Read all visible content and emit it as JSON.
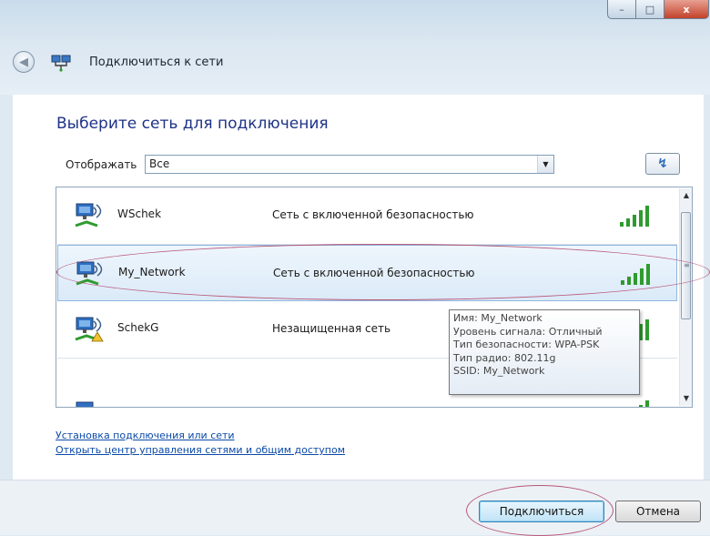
{
  "window": {
    "title": "Подключиться к сети",
    "controls": {
      "minimize": "–",
      "maximize": "□",
      "close": "x"
    }
  },
  "content": {
    "heading": "Выберите сеть для подключения",
    "filter": {
      "label": "Отображать",
      "value": "Все"
    }
  },
  "networks": [
    {
      "name": "WSchek",
      "status": "Сеть с включенной безопасностью",
      "secured": true,
      "signal_bars": 5
    },
    {
      "name": "My_Network",
      "status": "Сеть с включенной безопасностью",
      "secured": true,
      "signal_bars": 5,
      "selected": true
    },
    {
      "name": "SchekG",
      "status": "Незащищенная сеть",
      "secured": false,
      "signal_bars": 5
    }
  ],
  "tooltip": {
    "lines": [
      "Имя: My_Network",
      "Уровень сигнала: Отличный",
      "Тип безопасности: WPA-PSK",
      "Тип радио: 802.11g",
      "SSID: My_Network"
    ]
  },
  "links": [
    "Установка подключения или сети",
    "Открыть центр управления сетями и общим доступом"
  ],
  "buttons": {
    "connect": "Подключиться",
    "cancel": "Отмена"
  },
  "colors": {
    "accent": "#1e3287",
    "link": "#0b4aa8",
    "signal": "#2e9b2e",
    "highlight": "#b8577a"
  }
}
